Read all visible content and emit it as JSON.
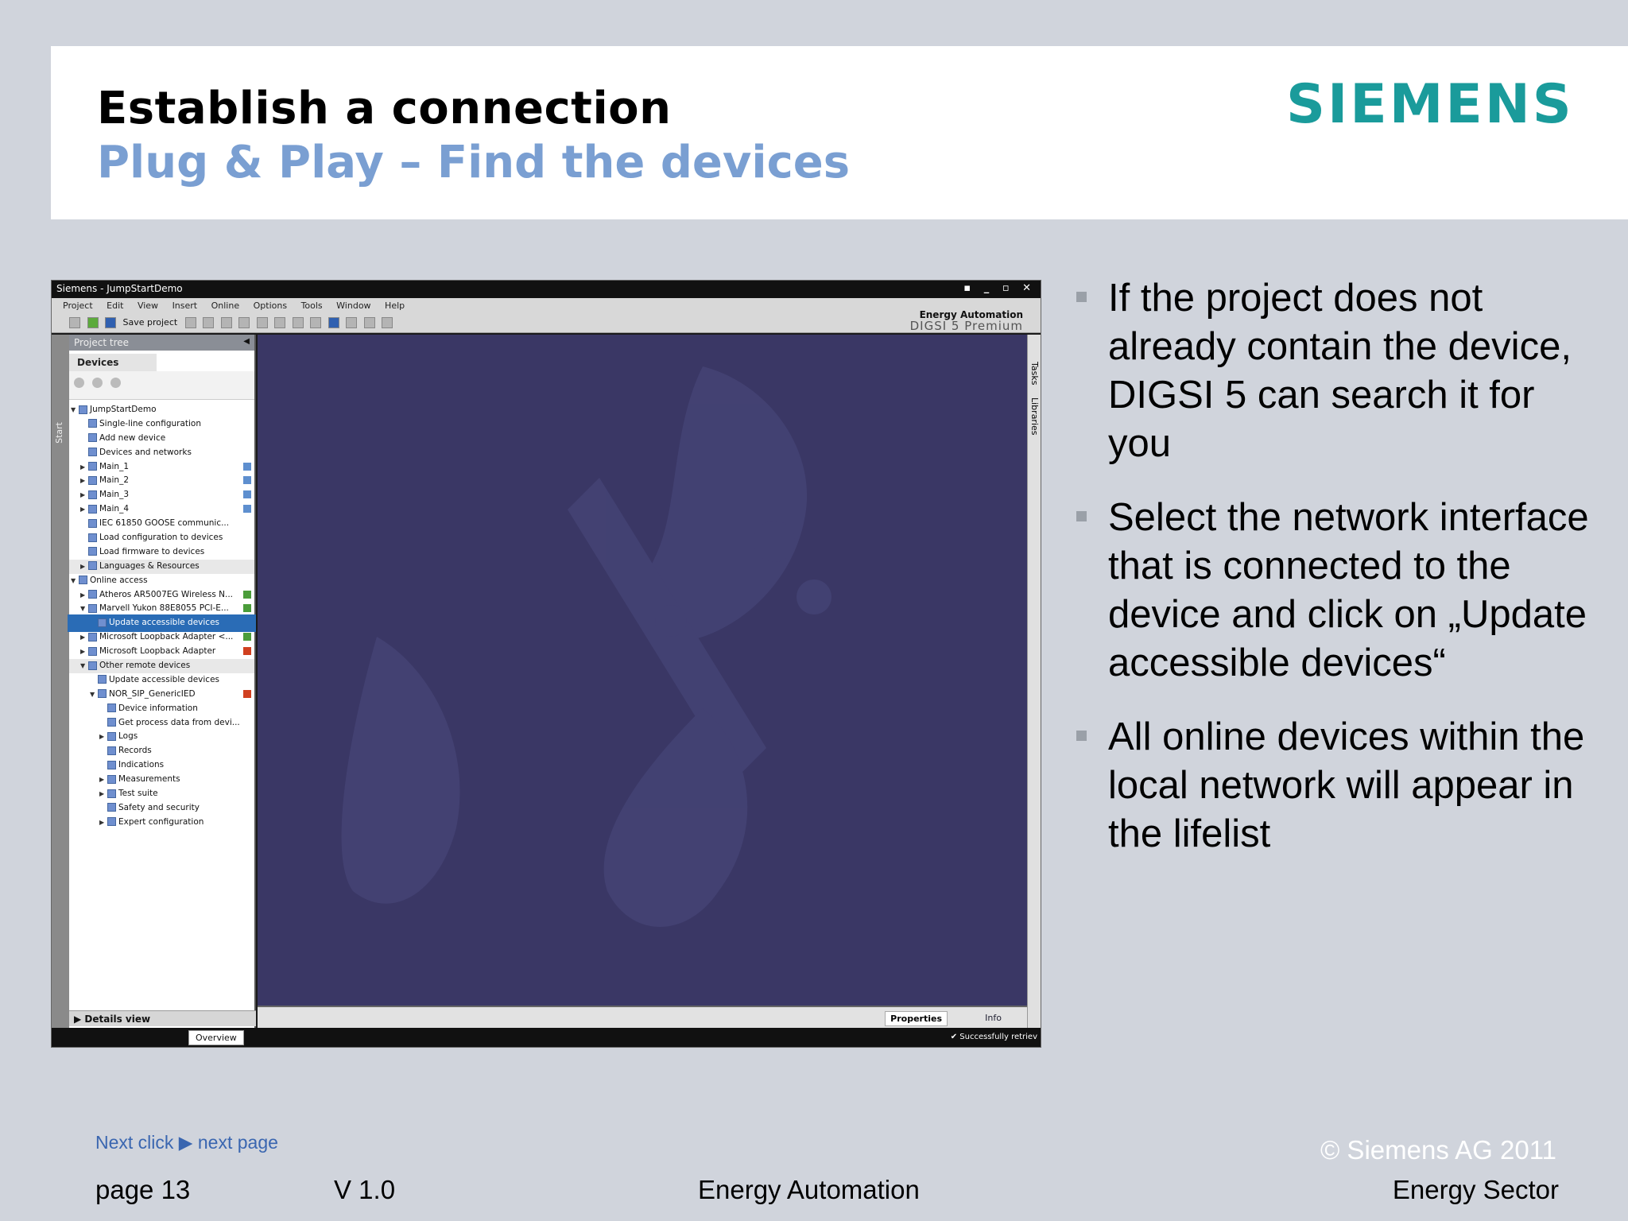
{
  "slide": {
    "title": "Establish a connection",
    "subtitle": "Plug & Play – Find the devices",
    "logo": "SIEMENS",
    "brand_color": "#1a9b9b"
  },
  "app": {
    "window_title": "Siemens  -  JumpStartDemo",
    "menu": [
      "Project",
      "Edit",
      "View",
      "Insert",
      "Online",
      "Options",
      "Tools",
      "Window",
      "Help"
    ],
    "save_label": "Save project",
    "brand_line1": "Energy Automation",
    "brand_line2": "DIGSI 5 Premium",
    "start_label": "Start",
    "project_tree_label": "Project tree",
    "devices_tab": "Devices",
    "tree_items": [
      {
        "label": "JumpStartDemo",
        "icon": "project-icon"
      },
      {
        "label": "Single-line configuration",
        "icon": "single-line-icon"
      },
      {
        "label": "Add new device",
        "icon": "add-device-icon"
      },
      {
        "label": "Devices and networks",
        "icon": "network-icon"
      },
      {
        "label": "Main_1",
        "icon": "device-icon"
      },
      {
        "label": "Main_2",
        "icon": "device-icon"
      },
      {
        "label": "Main_3",
        "icon": "device-icon"
      },
      {
        "label": "Main_4",
        "icon": "device-icon"
      },
      {
        "label": "IEC 61850 GOOSE communic...",
        "icon": "goose-icon"
      },
      {
        "label": "Load configuration to devices",
        "icon": "load-config-icon"
      },
      {
        "label": "Load firmware to devices",
        "icon": "load-firmware-icon"
      },
      {
        "label": "Languages & Resources",
        "icon": "folder-icon"
      },
      {
        "label": "Online access",
        "icon": "folder-icon"
      },
      {
        "label": "Atheros AR5007EG Wireless N...",
        "icon": "folder-icon"
      },
      {
        "label": "Marvell Yukon 88E8055 PCI-E...",
        "icon": "folder-icon"
      },
      {
        "label": "Update accessible devices",
        "icon": "update-devices-icon"
      },
      {
        "label": "Microsoft Loopback Adapter <...",
        "icon": "folder-icon"
      },
      {
        "label": "Microsoft Loopback Adapter",
        "icon": "folder-icon"
      },
      {
        "label": "Other remote devices",
        "icon": "folder-icon"
      },
      {
        "label": "Update accessible devices",
        "icon": "update-devices-icon"
      },
      {
        "label": "NOR_SIP_GenericIED",
        "icon": "device-icon"
      },
      {
        "label": "Device information",
        "icon": "info-icon"
      },
      {
        "label": "Get process data from devi...",
        "icon": "process-data-icon"
      },
      {
        "label": "Logs",
        "icon": "logs-icon"
      },
      {
        "label": "Records",
        "icon": "records-icon"
      },
      {
        "label": "Indications",
        "icon": "indications-icon"
      },
      {
        "label": "Measurements",
        "icon": "measurements-icon"
      },
      {
        "label": "Test suite",
        "icon": "test-icon"
      },
      {
        "label": "Safety and security",
        "icon": "security-icon"
      },
      {
        "label": "Expert configuration",
        "icon": "expert-icon"
      }
    ],
    "details_view": "Details view",
    "properties_tab": "Properties",
    "info_tab": "Info",
    "side_tab_tasks": "Tasks",
    "side_tab_libraries": "Libraries",
    "overview_tab": "Overview",
    "status_message": "Successfully retriev"
  },
  "bullets": [
    "If the project does not already contain the device, DIGSI 5 can search it for you",
    "Select the network interface that is connected to the device and click on „Update accessible devices“",
    "All online devices within the local network will appear in the lifelist"
  ],
  "footer": {
    "next_click": "Next click ▶ next page",
    "page": "page 13",
    "version": "V 1.0",
    "center": "Energy Automation",
    "copyright": "© Siemens AG 2011",
    "sector": "Energy Sector"
  }
}
